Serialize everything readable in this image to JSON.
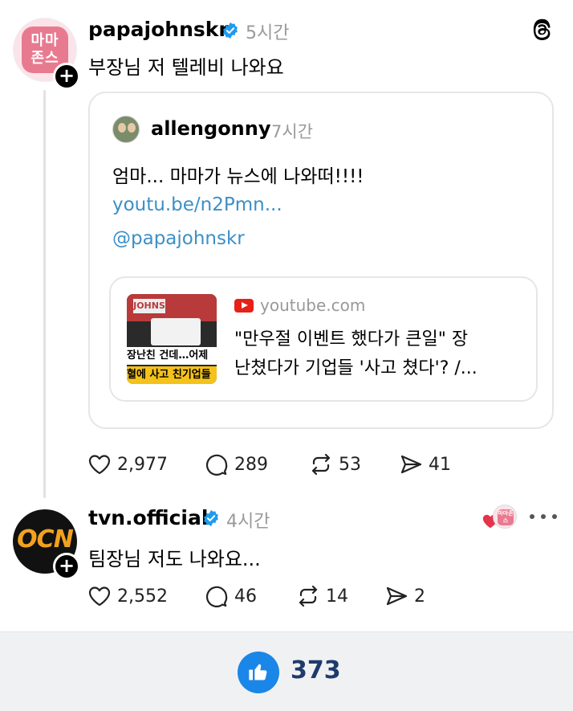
{
  "post1": {
    "username": "papajohnskr",
    "time": "5시간",
    "text": "부장님 저 텔레비 나와요",
    "avatar_text_line1": "마마",
    "avatar_text_line2": "존스",
    "actions": {
      "likes": "2,977",
      "replies": "289",
      "reposts": "53",
      "shares": "41"
    }
  },
  "quote": {
    "username": "allengonny",
    "time": "7시간",
    "text": "엄마... 마마가 뉴스에 나와떠!!!!",
    "link": "youtu.be/n2Pmn...",
    "mention": "@papajohnskr",
    "link_card": {
      "domain": "youtube.com",
      "title_line1": "\"만우절 이벤트 했다가 큰일\" 장",
      "title_line2": "난쳤다가 기업들 '사고 쳤다'? /...",
      "thumb_sign": "JOHNS",
      "thumb_caption1": "장난친 건데…어제",
      "thumb_caption2": "혈에 사고 친기업들"
    }
  },
  "post2": {
    "username": "tvn.official",
    "time": "4시간",
    "text": "팀장님 저도 나와요...",
    "avatar_text": "OCN",
    "liked_badge_text": "마마존스",
    "actions": {
      "likes": "2,552",
      "replies": "46",
      "reposts": "14",
      "shares": "2"
    }
  },
  "footer": {
    "like_count": "373"
  },
  "colors": {
    "link": "#3c8fc7",
    "verified": "#1d9bf0",
    "like_button": "#1a86e8",
    "brand_pink": "#e87a90"
  },
  "icons": [
    "threads-logo-icon",
    "verified-icon",
    "heart-icon",
    "comment-icon",
    "repost-icon",
    "share-icon",
    "youtube-icon",
    "thumbs-up-icon",
    "more-icon",
    "plus-icon"
  ]
}
